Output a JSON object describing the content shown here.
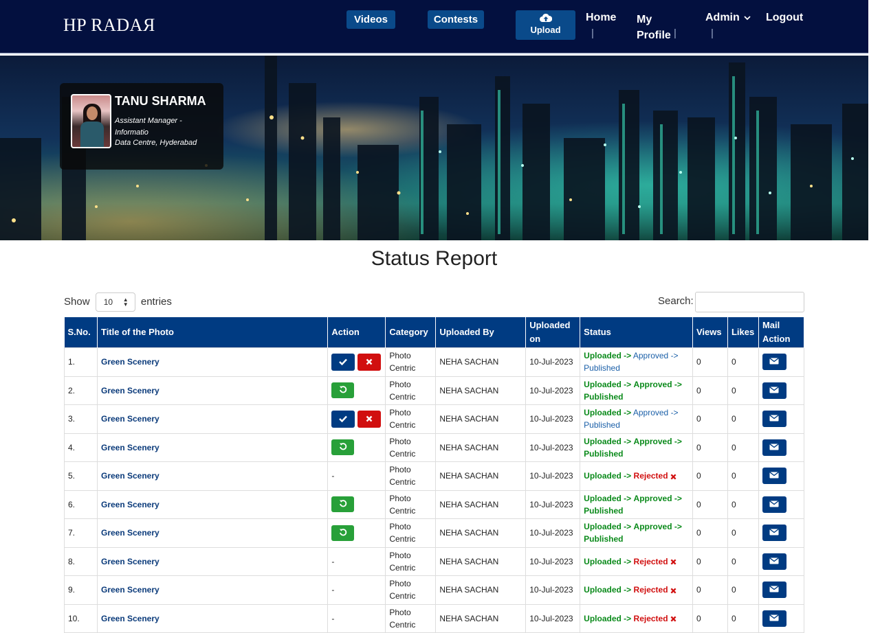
{
  "nav": {
    "brand": "HP RADAЯ",
    "videos": "Videos",
    "contests": "Contests",
    "upload": "Upload",
    "home": "Home",
    "my_profile": "My Profile",
    "admin": "Admin",
    "logout": "Logout",
    "separator": "|"
  },
  "profile": {
    "name": "TANU SHARMA",
    "role": "Assistant Manager - Informatio",
    "location": "Data Centre, Hyderabad"
  },
  "page_title": "Status Report",
  "controls": {
    "show_label": "Show",
    "entries_value": "10",
    "entries_label": "entries",
    "search_label": "Search:"
  },
  "table": {
    "headers": [
      "S.No.",
      "Title of the Photo",
      "Action",
      "Category",
      "Uploaded By",
      "Uploaded on",
      "Status",
      "Views",
      "Likes",
      "Mail Action"
    ],
    "rows": [
      {
        "sno": "1.",
        "title": "Green Scenery",
        "action": "approve-reject",
        "category": "Photo Centric",
        "by": "NEHA SACHAN",
        "on": "10-Jul-2023",
        "status": "pending",
        "views": "0",
        "likes": "0"
      },
      {
        "sno": "2.",
        "title": "Green Scenery",
        "action": "revert",
        "category": "Photo Centric",
        "by": "NEHA SACHAN",
        "on": "10-Jul-2023",
        "status": "published",
        "views": "0",
        "likes": "0"
      },
      {
        "sno": "3.",
        "title": "Green Scenery",
        "action": "approve-reject",
        "category": "Photo Centric",
        "by": "NEHA SACHAN",
        "on": "10-Jul-2023",
        "status": "pending",
        "views": "0",
        "likes": "0"
      },
      {
        "sno": "4.",
        "title": "Green Scenery",
        "action": "revert",
        "category": "Photo Centric",
        "by": "NEHA SACHAN",
        "on": "10-Jul-2023",
        "status": "published",
        "views": "0",
        "likes": "0"
      },
      {
        "sno": "5.",
        "title": "Green Scenery",
        "action": "none",
        "category": "Photo Centric",
        "by": "NEHA SACHAN",
        "on": "10-Jul-2023",
        "status": "rejected",
        "views": "0",
        "likes": "0"
      },
      {
        "sno": "6.",
        "title": "Green Scenery",
        "action": "revert",
        "category": "Photo Centric",
        "by": "NEHA SACHAN",
        "on": "10-Jul-2023",
        "status": "published",
        "views": "0",
        "likes": "0"
      },
      {
        "sno": "7.",
        "title": "Green Scenery",
        "action": "revert",
        "category": "Photo Centric",
        "by": "NEHA SACHAN",
        "on": "10-Jul-2023",
        "status": "published",
        "views": "0",
        "likes": "0"
      },
      {
        "sno": "8.",
        "title": "Green Scenery",
        "action": "none",
        "category": "Photo Centric",
        "by": "NEHA SACHAN",
        "on": "10-Jul-2023",
        "status": "rejected",
        "views": "0",
        "likes": "0"
      },
      {
        "sno": "9.",
        "title": "Green Scenery",
        "action": "none",
        "category": "Photo Centric",
        "by": "NEHA SACHAN",
        "on": "10-Jul-2023",
        "status": "rejected",
        "views": "0",
        "likes": "0"
      },
      {
        "sno": "10.",
        "title": "Green Scenery",
        "action": "none",
        "category": "Photo Centric",
        "by": "NEHA SACHAN",
        "on": "10-Jul-2023",
        "status": "rejected",
        "views": "0",
        "likes": "0"
      }
    ]
  },
  "status_text": {
    "uploaded": "Uploaded ->",
    "approved": "Approved ->",
    "published": "Published",
    "rejected": "Rejected",
    "no_action": "-"
  },
  "icons": {
    "approve": "check-icon",
    "reject": "times-icon",
    "revert": "undo-icon",
    "mail": "envelope-icon",
    "upload": "cloud-upload-icon",
    "admin_caret": "chevron-down-icon"
  },
  "colors": {
    "navbar": "#03103f",
    "primary": "#003b82",
    "success": "#28a039",
    "danger": "#d10f0f",
    "status_green": "#0a8a1a",
    "status_blue": "#1a5fa8"
  }
}
